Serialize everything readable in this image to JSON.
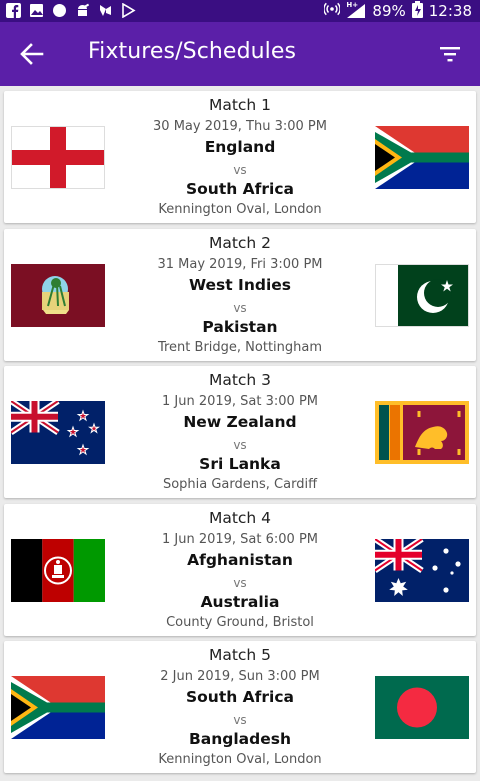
{
  "status_bar": {
    "battery": "89%",
    "time": "12:38",
    "network": "H+",
    "icons": [
      "facebook-icon",
      "image-icon",
      "circle-icon",
      "android-icon",
      "cleaner-icon",
      "play-store-icon"
    ]
  },
  "app_bar": {
    "title": "Fixtures/Schedules",
    "back_icon": "arrow-left-icon",
    "filter_icon": "filter-icon",
    "color": "#5b1fa8",
    "status_color": "#3a0e82"
  },
  "matches": [
    {
      "label": "Match 1",
      "datetime": "30 May 2019, Thu 3:00 PM",
      "team1": "England",
      "vs": "vs",
      "team2": "South Africa",
      "venue": "Kennington Oval, London",
      "flag1": "england-flag",
      "flag2": "south-africa-flag"
    },
    {
      "label": "Match 2",
      "datetime": "31 May 2019, Fri 3:00 PM",
      "team1": "West Indies",
      "vs": "vs",
      "team2": "Pakistan",
      "venue": "Trent Bridge, Nottingham",
      "flag1": "west-indies-flag",
      "flag2": "pakistan-flag"
    },
    {
      "label": "Match 3",
      "datetime": "1 Jun 2019, Sat 3:00 PM",
      "team1": "New Zealand",
      "vs": "vs",
      "team2": "Sri Lanka",
      "venue": "Sophia Gardens, Cardiff",
      "flag1": "new-zealand-flag",
      "flag2": "sri-lanka-flag"
    },
    {
      "label": "Match 4",
      "datetime": "1 Jun 2019, Sat 6:00 PM",
      "team1": "Afghanistan",
      "vs": "vs",
      "team2": "Australia",
      "venue": "County Ground, Bristol",
      "flag1": "afghanistan-flag",
      "flag2": "australia-flag"
    },
    {
      "label": "Match 5",
      "datetime": "2 Jun 2019, Sun 3:00 PM",
      "team1": "South Africa",
      "vs": "vs",
      "team2": "Bangladesh",
      "venue": "Kennington Oval, London",
      "flag1": "south-africa-flag",
      "flag2": "bangladesh-flag"
    }
  ]
}
